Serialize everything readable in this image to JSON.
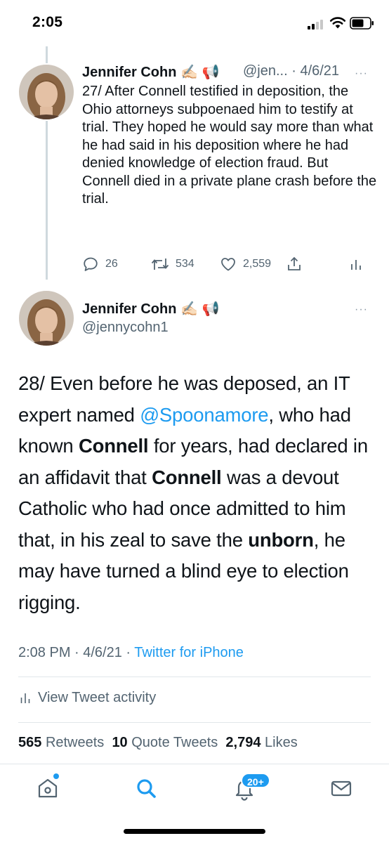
{
  "status_bar": {
    "time": "2:05"
  },
  "reply_tweet": {
    "author_name": "Jennifer Cohn ✍🏻 📢",
    "handle": "@jen...",
    "date": "· 4/6/21",
    "more": "···",
    "text": "27/ After Connell testified in deposition, the Ohio attorneys subpoenaed him to testify at trial. They hoped he would say more than what he had said in his deposition where he had denied knowledge of election fraud. But Connell died in a private plane crash before the trial.",
    "replies": "26",
    "retweets": "534",
    "likes": "2,559"
  },
  "main_tweet": {
    "author_name": "Jennifer Cohn ✍🏻 📢",
    "handle": "@jennycohn1",
    "more": "···",
    "text_parts": {
      "p1": "28/ Even before he was deposed, an IT expert named ",
      "mention": "@Spoonamore",
      "p2": ", who had known ",
      "b1": "Connell",
      "p3": " for years, had declared in an affidavit that ",
      "b2": "Connell",
      "p4": " was a devout Catholic who had once admitted to him that, in his zeal to save the ",
      "b3": "unborn",
      "p5": ", he may have turned a blind eye to election rigging."
    },
    "timestamp": "2:08 PM · 4/6/21 · ",
    "source": "Twitter for iPhone",
    "view_activity": "View Tweet activity",
    "stats": {
      "retweets_count": "565",
      "retweets_label": "Retweets",
      "quotes_count": "10",
      "quotes_label": "Quote Tweets",
      "likes_count": "2,794",
      "likes_label": "Likes"
    }
  },
  "tab_bar": {
    "notifications_badge": "20+",
    "tabs": [
      "home-icon",
      "search-icon",
      "bell-icon",
      "mail-icon"
    ]
  },
  "colors": {
    "accent": "#1d9bf0",
    "text": "#0f1419",
    "muted": "#536471"
  }
}
